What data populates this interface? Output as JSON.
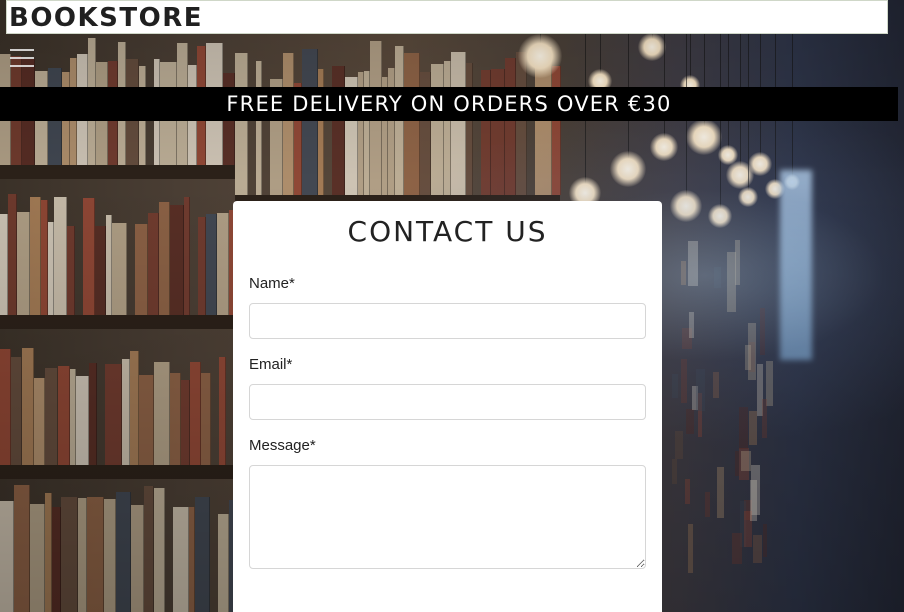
{
  "header": {
    "brand": "BOOKSTORE",
    "menu_icon": "hamburger-menu-icon"
  },
  "banner": {
    "text": "FREE DELIVERY ON ORDERS OVER €30"
  },
  "contact_form": {
    "title": "CONTACT US",
    "fields": {
      "name": {
        "label": "Name*",
        "value": "",
        "placeholder": ""
      },
      "email": {
        "label": "Email*",
        "value": "",
        "placeholder": ""
      },
      "message": {
        "label": "Message*",
        "value": "",
        "placeholder": ""
      }
    }
  },
  "colors": {
    "banner_bg": "#000000",
    "banner_text": "#ffffff",
    "card_bg": "#ffffff",
    "brand_text": "#202020"
  }
}
